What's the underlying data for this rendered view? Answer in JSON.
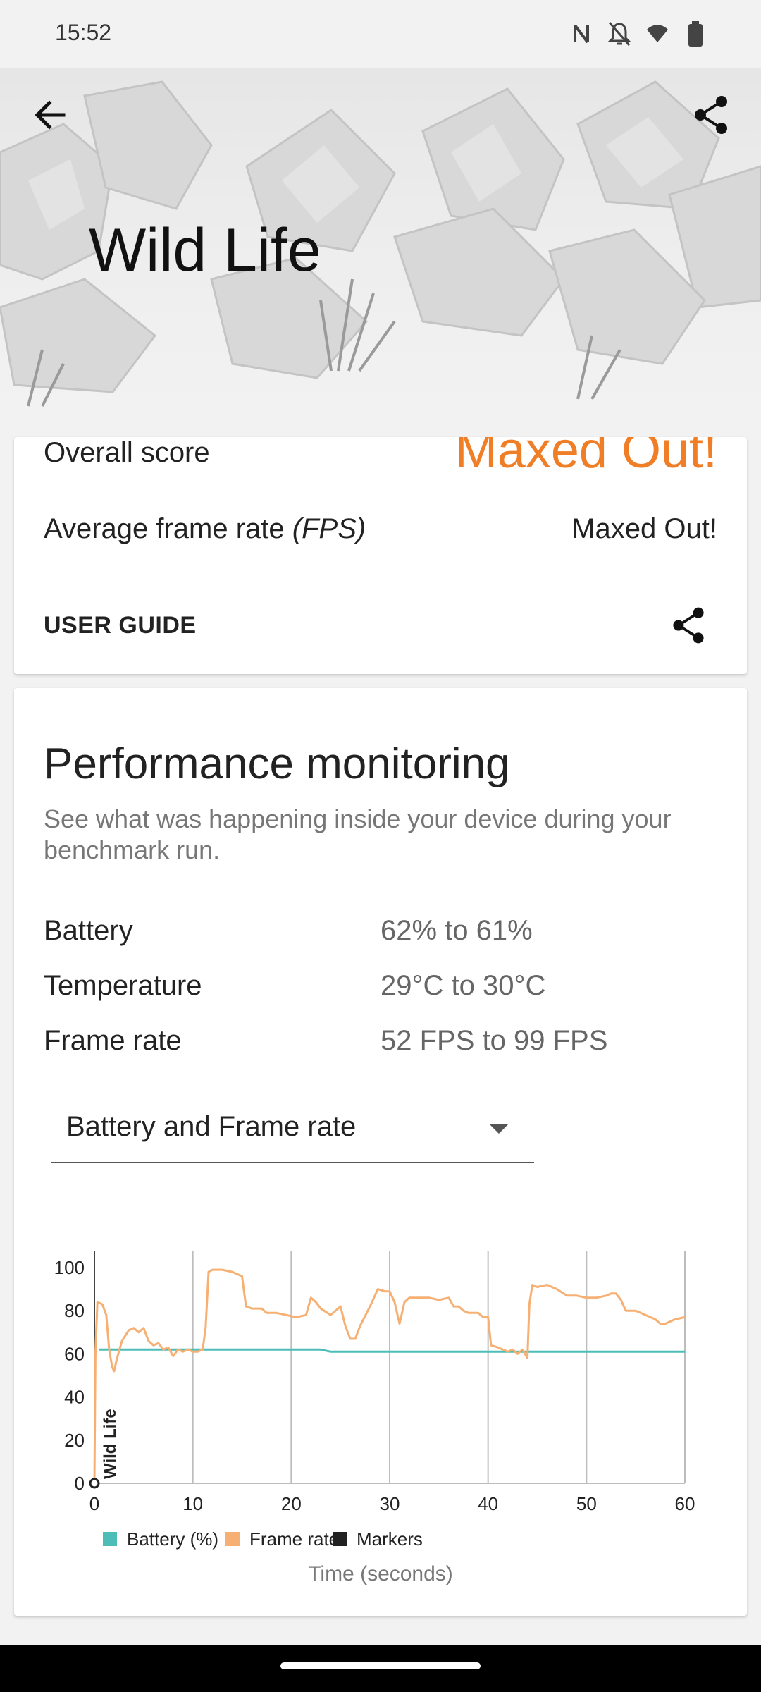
{
  "status_bar": {
    "time": "15:52",
    "icons": [
      "nfc-icon",
      "bell-off-icon",
      "wifi-icon",
      "battery-icon"
    ]
  },
  "header": {
    "title": "Wild Life",
    "back_icon": "arrow-back-icon",
    "share_icon": "share-icon"
  },
  "score_card": {
    "overall_label": "Overall score",
    "overall_value": "Maxed Out!",
    "fps_label_main": "Average frame rate ",
    "fps_label_italic": "(FPS)",
    "fps_value": "Maxed Out!",
    "user_guide_label": "USER GUIDE",
    "share_icon": "share-icon"
  },
  "performance": {
    "title": "Performance monitoring",
    "description": "See what was happening inside your device during your benchmark run.",
    "stats": [
      {
        "label": "Battery",
        "value": "62% to 61%"
      },
      {
        "label": "Temperature",
        "value": "29°C to 30°C"
      },
      {
        "label": "Frame rate",
        "value": "52 FPS to 99 FPS"
      }
    ],
    "dropdown_selected": "Battery and Frame rate"
  },
  "colors": {
    "accent": "#f07e26",
    "battery": "#4dbdb8",
    "frame_rate": "#f6b074",
    "markers": "#222222"
  },
  "chart_data": {
    "type": "line",
    "xlabel": "Time (seconds)",
    "x_ticks": [
      "0",
      "10",
      "20",
      "30",
      "40",
      "50",
      "60"
    ],
    "y_ticks": [
      "0",
      "20",
      "40",
      "60",
      "80",
      "100"
    ],
    "xlim": [
      0,
      60
    ],
    "ylim": [
      0,
      100
    ],
    "grid": "vertical",
    "legend": [
      "Battery (%)",
      "Frame rate",
      "Markers"
    ],
    "marker_label": "Wild Life",
    "marker_x": 0,
    "series": [
      {
        "name": "Battery (%)",
        "color": "#4dbdb8",
        "points": [
          [
            0.5,
            62
          ],
          [
            23,
            62
          ],
          [
            24,
            61
          ],
          [
            60,
            61
          ]
        ]
      },
      {
        "name": "Frame rate",
        "color": "#f6b074",
        "points": [
          [
            0,
            0
          ],
          [
            0.1,
            60
          ],
          [
            0.3,
            84
          ],
          [
            0.8,
            83
          ],
          [
            1.2,
            78
          ],
          [
            1.5,
            62
          ],
          [
            1.8,
            54
          ],
          [
            2.0,
            52
          ],
          [
            2.3,
            58
          ],
          [
            2.8,
            66
          ],
          [
            3.5,
            71
          ],
          [
            4.0,
            72
          ],
          [
            4.5,
            70
          ],
          [
            5.0,
            72
          ],
          [
            5.5,
            66
          ],
          [
            6.0,
            64
          ],
          [
            6.5,
            65
          ],
          [
            7.0,
            62
          ],
          [
            7.5,
            63
          ],
          [
            8.0,
            59
          ],
          [
            8.5,
            62
          ],
          [
            9.0,
            61
          ],
          [
            9.5,
            62
          ],
          [
            10.0,
            61
          ],
          [
            10.5,
            61
          ],
          [
            11.0,
            62
          ],
          [
            11.3,
            72
          ],
          [
            11.6,
            98
          ],
          [
            12.0,
            99
          ],
          [
            13.0,
            99
          ],
          [
            14.0,
            98
          ],
          [
            15.0,
            96
          ],
          [
            15.4,
            82
          ],
          [
            16.0,
            81
          ],
          [
            17.0,
            81
          ],
          [
            17.5,
            79
          ],
          [
            18.5,
            79
          ],
          [
            19.5,
            78
          ],
          [
            20.5,
            77
          ],
          [
            21.5,
            78
          ],
          [
            22.0,
            86
          ],
          [
            22.5,
            84
          ],
          [
            23.0,
            81
          ],
          [
            24.0,
            78
          ],
          [
            25.0,
            82
          ],
          [
            25.5,
            73
          ],
          [
            26.0,
            67
          ],
          [
            26.5,
            67
          ],
          [
            27.0,
            73
          ],
          [
            28.0,
            82
          ],
          [
            28.8,
            90
          ],
          [
            29.5,
            89
          ],
          [
            30.0,
            89
          ],
          [
            30.5,
            84
          ],
          [
            31.0,
            74
          ],
          [
            31.5,
            84
          ],
          [
            32.0,
            86
          ],
          [
            33.0,
            86
          ],
          [
            34.0,
            86
          ],
          [
            35.0,
            85
          ],
          [
            36.0,
            86
          ],
          [
            36.5,
            82
          ],
          [
            37.0,
            82
          ],
          [
            37.5,
            80
          ],
          [
            38.0,
            79
          ],
          [
            39.0,
            79
          ],
          [
            39.5,
            77
          ],
          [
            40.0,
            77
          ],
          [
            40.3,
            64
          ],
          [
            41.0,
            63
          ],
          [
            42.0,
            61
          ],
          [
            42.5,
            62
          ],
          [
            43.0,
            60
          ],
          [
            43.5,
            62
          ],
          [
            44.0,
            58
          ],
          [
            44.2,
            83
          ],
          [
            44.5,
            92
          ],
          [
            45.0,
            91
          ],
          [
            46.0,
            92
          ],
          [
            47.0,
            90
          ],
          [
            48.0,
            87
          ],
          [
            49.0,
            87
          ],
          [
            50.0,
            86
          ],
          [
            51.0,
            86
          ],
          [
            52.0,
            87
          ],
          [
            52.5,
            88
          ],
          [
            53.0,
            88
          ],
          [
            53.5,
            85
          ],
          [
            54.0,
            80
          ],
          [
            55.0,
            80
          ],
          [
            56.0,
            78
          ],
          [
            57.0,
            76
          ],
          [
            57.5,
            74
          ],
          [
            58.0,
            74
          ],
          [
            59.0,
            76
          ],
          [
            60.0,
            77
          ]
        ]
      }
    ]
  }
}
